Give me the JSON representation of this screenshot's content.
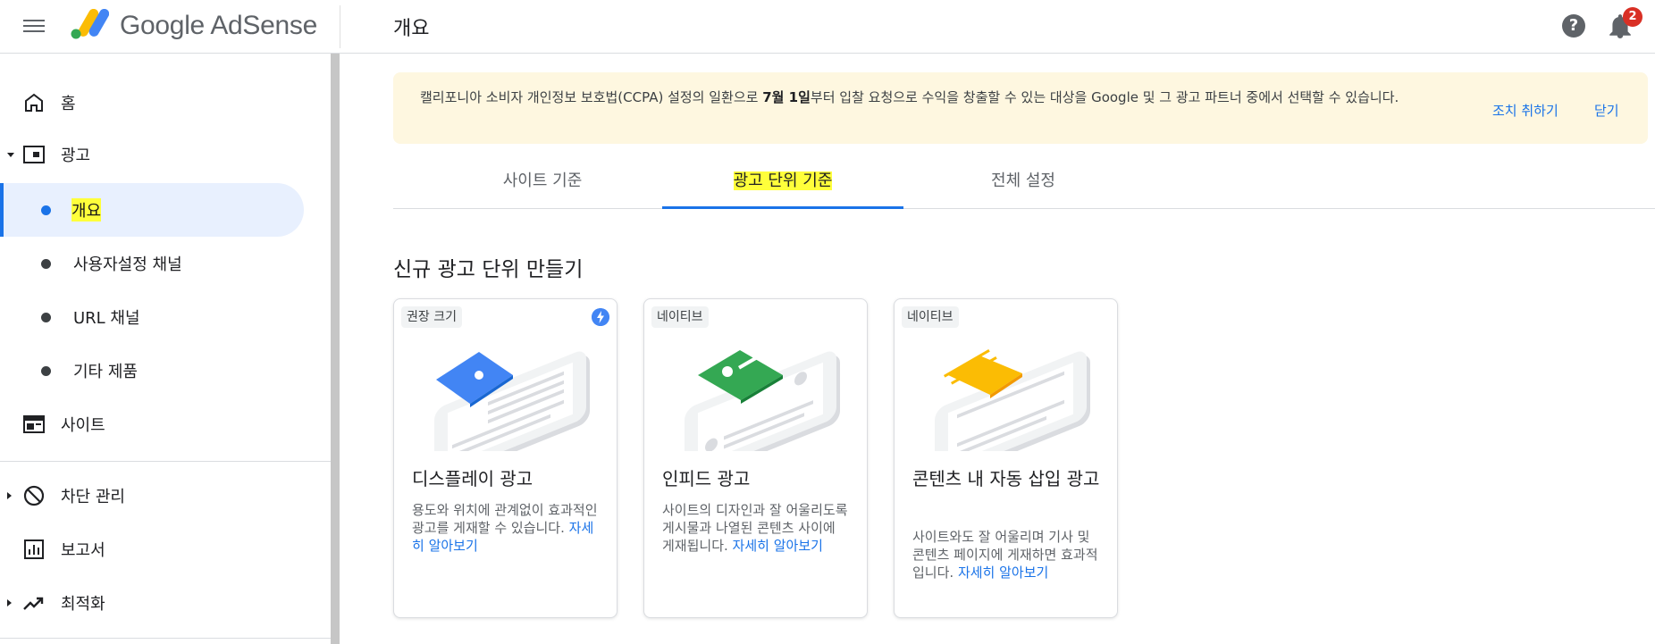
{
  "header": {
    "logo_text": "Google AdSense",
    "page_title": "개요",
    "help_symbol": "?",
    "notification_count": "2"
  },
  "sidebar": {
    "home": "홈",
    "ads": "광고",
    "ads_overview": "개요",
    "custom_channels": "사용자설정 채널",
    "url_channels": "URL 채널",
    "other_products": "기타 제품",
    "sites": "사이트",
    "blocking_controls": "차단 관리",
    "reports": "보고서",
    "optimization": "최적화"
  },
  "banner": {
    "text_before": "캘리포니아 소비자 개인정보 보호법(CCPA) 설정의 일환으로 ",
    "text_bold": "7월 1일",
    "text_after": "부터 입찰 요청으로 수익을 창출할 수 있는 대상을 Google 및 그 광고 파트너 중에서 선택할 수 있습니다.",
    "action": "조치 취하기",
    "dismiss": "닫기"
  },
  "tabs": {
    "by_site": "사이트 기준",
    "by_ad_unit": "광고 단위 기준",
    "global_settings": "전체 설정"
  },
  "section_title": "신규 광고 단위 만들기",
  "cards": [
    {
      "chip": "권장 크기",
      "title": "디스플레이 광고",
      "desc": "용도와 위치에 관계없이 효과적인 광고를 게재할 수 있습니다. ",
      "link": "자세히 알아보기"
    },
    {
      "chip": "네이티브",
      "title": "인피드 광고",
      "desc": "사이트의 디자인과 잘 어울리도록 게시물과 나열된 콘텐츠 사이에 게재됩니다. ",
      "link": "자세히 알아보기"
    },
    {
      "chip": "네이티브",
      "title": "콘텐츠 내 자동 삽입 광고",
      "desc": "사이트와도 잘 어울리며 기사 및 콘텐츠 페이지에 게재하면 효과적입니다. ",
      "link": "자세히 알아보기"
    }
  ],
  "colors": {
    "accent": "#1a73e8",
    "banner_bg": "#fef7e0",
    "highlight": "#ffff3b",
    "display_illus": "#4285f4",
    "infeed_illus": "#34a853",
    "inarticle_illus": "#fbbc04"
  }
}
